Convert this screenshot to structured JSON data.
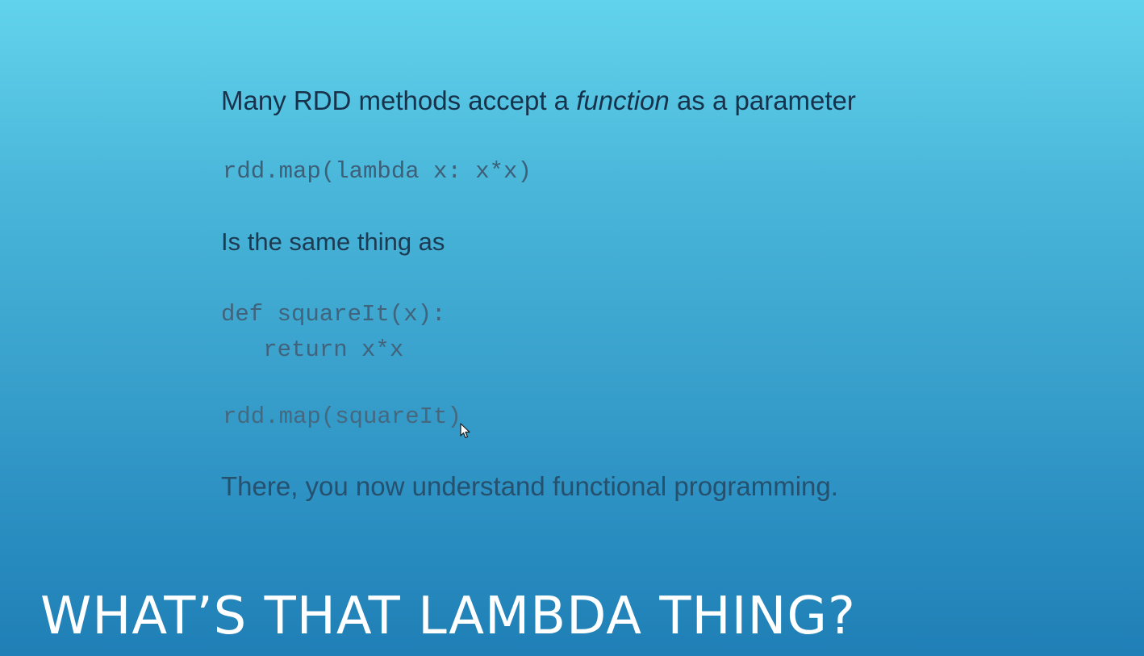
{
  "slide": {
    "intro": {
      "before": "Many RDD methods accept a ",
      "emphasis": "function",
      "after": " as a parameter"
    },
    "code_lambda": "rdd.map(lambda x: x*x)",
    "same_thing": "Is the same thing as",
    "code_def": "def squareIt(x):\n   return x*x",
    "code_map": "rdd.map(squareIt)",
    "closing": "There, you now understand functional programming.",
    "title": "WHAT’S THAT LAMBDA THING?"
  },
  "icons": {
    "cursor": "mouse-pointer-icon"
  },
  "colors": {
    "background_top": "#62d3ec",
    "background_bottom": "#1f7fb6",
    "title": "#ffffff",
    "body_text": "#1f3f58"
  }
}
